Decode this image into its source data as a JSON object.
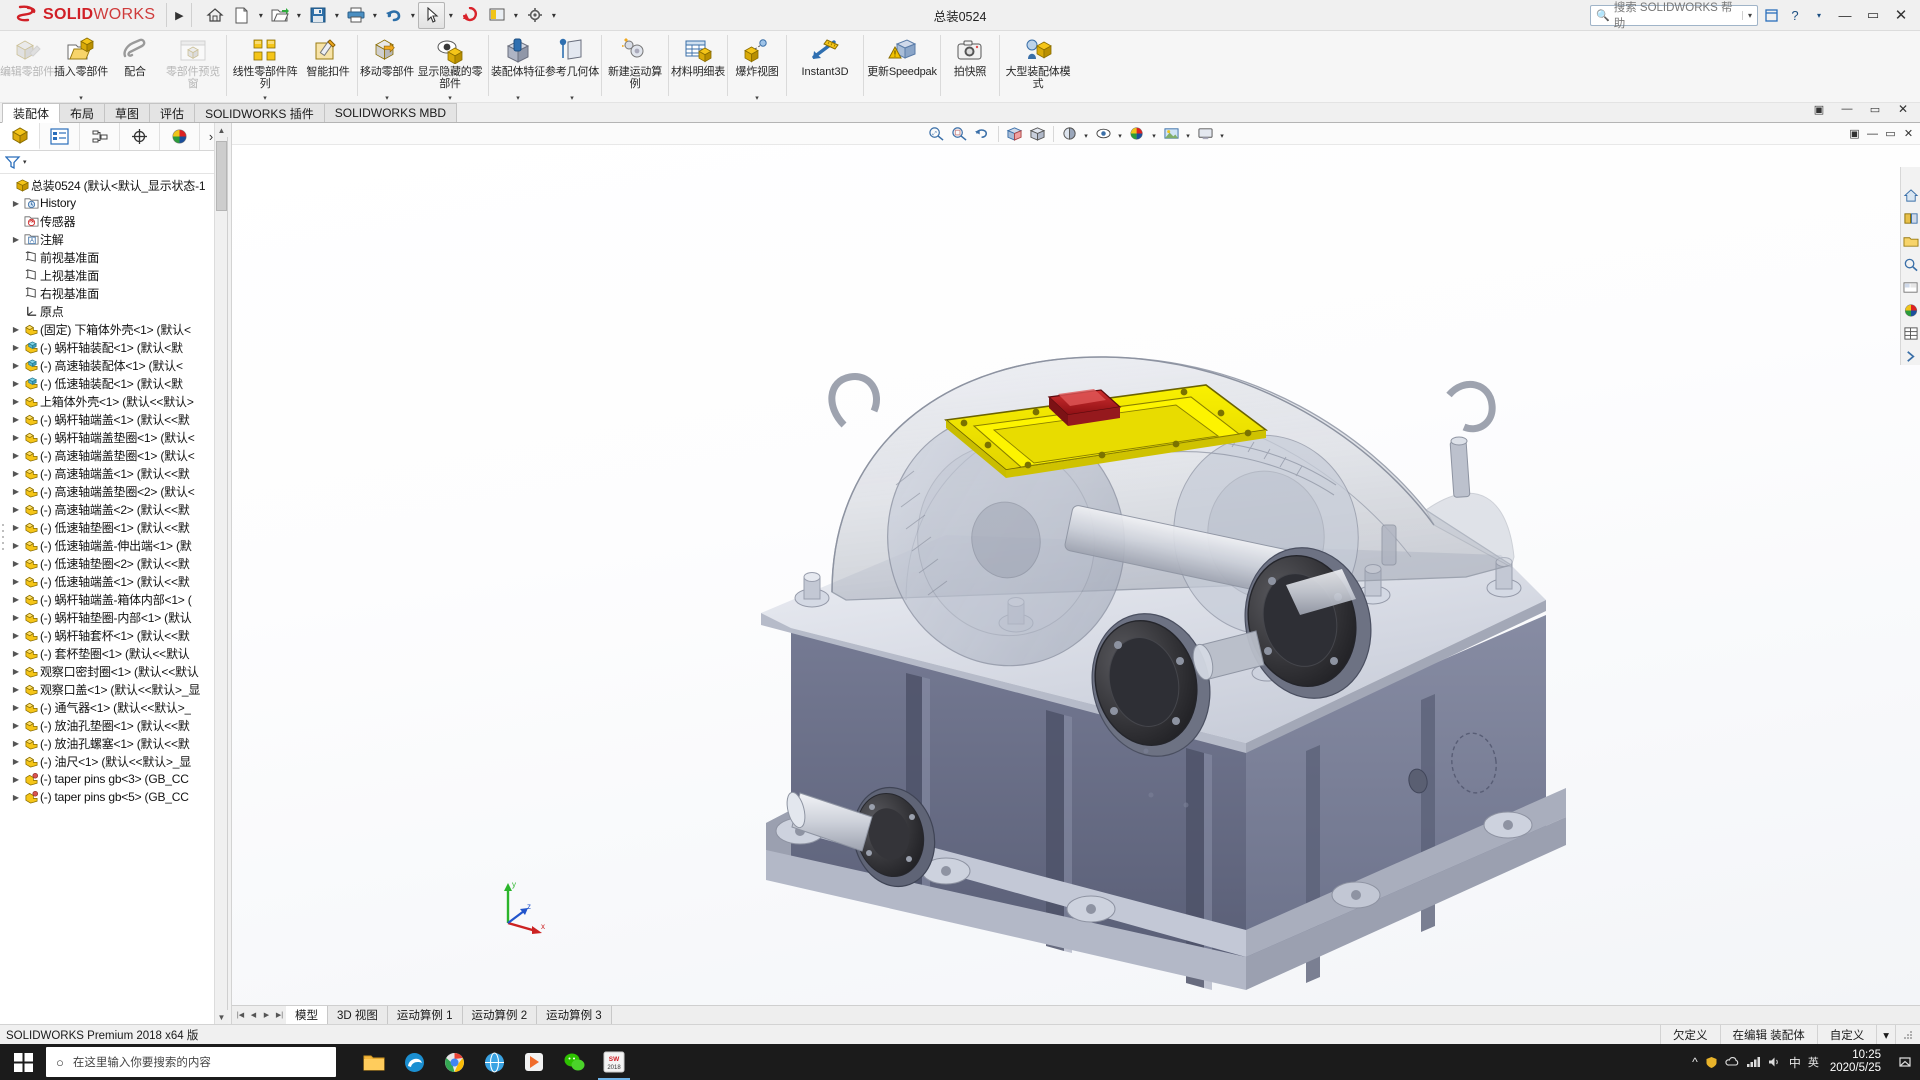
{
  "titlebar": {
    "logo_mark": "DS",
    "logo_bold": "SOLID",
    "logo_light": "WORKS",
    "document_title": "总装0524",
    "quick_access": [
      {
        "name": "home-icon",
        "label": "主页"
      },
      {
        "name": "new-document-icon",
        "label": "新建"
      },
      {
        "name": "open-folder-icon",
        "label": "打开"
      },
      {
        "name": "save-icon",
        "label": "保存"
      },
      {
        "name": "print-icon",
        "label": "打印"
      },
      {
        "name": "undo-icon",
        "label": "撤销"
      },
      {
        "name": "select-cursor-icon",
        "label": "选择"
      },
      {
        "name": "rebuild-icon",
        "label": "重建模型"
      },
      {
        "name": "display-icon",
        "label": "显示"
      },
      {
        "name": "options-gear-icon",
        "label": "选项"
      }
    ],
    "search_placeholder": "搜索 SOLIDWORKS 帮助",
    "help_label": "?",
    "minimize": "—",
    "maximize": "▭",
    "close": "✕"
  },
  "ribbon": {
    "items": [
      {
        "label": "编辑零部件",
        "icon": "edit-component-icon",
        "disabled": true,
        "caret": false
      },
      {
        "label": "插入零部件",
        "icon": "insert-component-icon",
        "disabled": false,
        "caret": true
      },
      {
        "label": "配合",
        "icon": "mate-icon",
        "disabled": false,
        "caret": false
      },
      {
        "label": "零部件预览窗",
        "icon": "component-preview-icon",
        "disabled": true,
        "caret": false
      },
      {
        "label": "线性零部件阵列",
        "icon": "linear-pattern-icon",
        "disabled": false,
        "caret": true
      },
      {
        "label": "智能扣件",
        "icon": "smart-fastener-icon",
        "disabled": false,
        "caret": false
      },
      {
        "label": "移动零部件",
        "icon": "move-component-icon",
        "disabled": false,
        "caret": true
      },
      {
        "label": "显示隐藏的零部件",
        "icon": "show-hidden-components-icon",
        "disabled": false,
        "caret": true
      },
      {
        "label": "装配体特征",
        "icon": "assembly-feature-icon",
        "disabled": false,
        "caret": true
      },
      {
        "label": "参考几何体",
        "icon": "reference-geometry-icon",
        "disabled": false,
        "caret": true
      },
      {
        "label": "新建运动算例",
        "icon": "new-motion-study-icon",
        "disabled": false,
        "caret": false
      },
      {
        "label": "材料明细表",
        "icon": "bill-of-materials-icon",
        "disabled": false,
        "caret": false
      },
      {
        "label": "爆炸视图",
        "icon": "exploded-view-icon",
        "disabled": false,
        "caret": true
      },
      {
        "label": "Instant3D",
        "icon": "instant3d-icon",
        "disabled": false,
        "caret": false,
        "en": true
      },
      {
        "label": "更新Speedpak",
        "icon": "update-speedpak-icon",
        "disabled": false,
        "caret": false
      },
      {
        "label": "拍快照",
        "icon": "take-snapshot-icon",
        "disabled": false,
        "caret": false
      },
      {
        "label": "大型装配体模式",
        "icon": "large-assembly-mode-icon",
        "disabled": false,
        "caret": false
      }
    ]
  },
  "command_tabs": {
    "items": [
      "装配体",
      "布局",
      "草图",
      "评估",
      "SOLIDWORKS 插件",
      "SOLIDWORKS MBD"
    ],
    "active_index": 0,
    "window_buttons": [
      "▣",
      "—",
      "▭",
      "✕"
    ]
  },
  "feature_manager": {
    "tabs": [
      {
        "name": "feature-tree-tab",
        "icon": "assembly-tree-icon",
        "active": true
      },
      {
        "name": "property-manager-tab",
        "icon": "property-manager-icon",
        "active": false
      },
      {
        "name": "configuration-manager-tab",
        "icon": "configuration-manager-icon",
        "active": false
      },
      {
        "name": "dimxpert-manager-tab",
        "icon": "dimxpert-icon",
        "active": false
      },
      {
        "name": "display-manager-tab",
        "icon": "display-manager-icon",
        "active": false
      }
    ],
    "more_tabs": "›",
    "filter_icon": "filter-funnel-icon",
    "tree": [
      {
        "label": "总装0524  (默认<默认_显示状态-1",
        "icon": "assembly-icon",
        "indent": 0,
        "expand": false,
        "root": true
      },
      {
        "label": "History",
        "icon": "history-icon",
        "indent": 1,
        "expand": true
      },
      {
        "label": "传感器",
        "icon": "sensors-icon",
        "indent": 1,
        "expand": false
      },
      {
        "label": "注解",
        "icon": "annotations-icon",
        "indent": 1,
        "expand": true
      },
      {
        "label": "前视基准面",
        "icon": "plane-icon",
        "indent": 1,
        "expand": false
      },
      {
        "label": "上视基准面",
        "icon": "plane-icon",
        "indent": 1,
        "expand": false
      },
      {
        "label": "右视基准面",
        "icon": "plane-icon",
        "indent": 1,
        "expand": false
      },
      {
        "label": "原点",
        "icon": "origin-icon",
        "indent": 1,
        "expand": false
      },
      {
        "label": "(固定) 下箱体外壳<1> (默认<",
        "icon": "part-icon",
        "indent": 1,
        "expand": true
      },
      {
        "label": "(-) 蜗杆轴装配<1> (默认<默",
        "icon": "subassembly-icon",
        "indent": 1,
        "expand": true
      },
      {
        "label": "(-) 高速轴装配体<1> (默认<",
        "icon": "subassembly-icon",
        "indent": 1,
        "expand": true
      },
      {
        "label": "(-) 低速轴装配<1> (默认<默",
        "icon": "subassembly-icon",
        "indent": 1,
        "expand": true
      },
      {
        "label": "上箱体外壳<1> (默认<<默认>",
        "icon": "part-icon",
        "indent": 1,
        "expand": true
      },
      {
        "label": "(-) 蜗杆轴端盖<1> (默认<<默",
        "icon": "part-icon",
        "indent": 1,
        "expand": true
      },
      {
        "label": "(-) 蜗杆轴端盖垫圈<1> (默认<",
        "icon": "part-icon",
        "indent": 1,
        "expand": true
      },
      {
        "label": "(-) 高速轴端盖垫圈<1> (默认<",
        "icon": "part-icon",
        "indent": 1,
        "expand": true
      },
      {
        "label": "(-) 高速轴端盖<1> (默认<<默",
        "icon": "part-icon",
        "indent": 1,
        "expand": true
      },
      {
        "label": "(-) 高速轴端盖垫圈<2> (默认<",
        "icon": "part-icon",
        "indent": 1,
        "expand": true
      },
      {
        "label": "(-) 高速轴端盖<2> (默认<<默",
        "icon": "part-icon",
        "indent": 1,
        "expand": true
      },
      {
        "label": "(-) 低速轴垫圈<1> (默认<<默",
        "icon": "part-icon",
        "indent": 1,
        "expand": true
      },
      {
        "label": "(-) 低速轴端盖-伸出端<1> (默",
        "icon": "part-icon",
        "indent": 1,
        "expand": true
      },
      {
        "label": "(-) 低速轴垫圈<2> (默认<<默",
        "icon": "part-icon",
        "indent": 1,
        "expand": true
      },
      {
        "label": "(-) 低速轴端盖<1> (默认<<默",
        "icon": "part-icon",
        "indent": 1,
        "expand": true
      },
      {
        "label": "(-) 蜗杆轴端盖-箱体内部<1> (",
        "icon": "part-icon",
        "indent": 1,
        "expand": true
      },
      {
        "label": "(-) 蜗杆轴垫圈-内部<1> (默认",
        "icon": "part-icon",
        "indent": 1,
        "expand": true
      },
      {
        "label": "(-) 蜗杆轴套杯<1> (默认<<默",
        "icon": "part-icon",
        "indent": 1,
        "expand": true
      },
      {
        "label": "(-) 套杯垫圈<1> (默认<<默认",
        "icon": "part-icon",
        "indent": 1,
        "expand": true
      },
      {
        "label": "观察口密封圈<1> (默认<<默认",
        "icon": "part-icon",
        "indent": 1,
        "expand": true
      },
      {
        "label": "观察口盖<1> (默认<<默认>_显",
        "icon": "part-icon",
        "indent": 1,
        "expand": true
      },
      {
        "label": "(-) 通气器<1> (默认<<默认>_",
        "icon": "part-icon",
        "indent": 1,
        "expand": true
      },
      {
        "label": "(-) 放油孔垫圈<1> (默认<<默",
        "icon": "part-icon",
        "indent": 1,
        "expand": true
      },
      {
        "label": "(-) 放油孔螺塞<1> (默认<<默",
        "icon": "part-icon",
        "indent": 1,
        "expand": true
      },
      {
        "label": "(-) 油尺<1> (默认<<默认>_显",
        "icon": "part-icon",
        "indent": 1,
        "expand": true
      },
      {
        "label": "(-) taper pins gb<3> (GB_CC",
        "icon": "toolbox-part-icon",
        "indent": 1,
        "expand": true
      },
      {
        "label": "(-) taper pins gb<5> (GB_CC",
        "icon": "toolbox-part-icon",
        "indent": 1,
        "expand": true
      }
    ]
  },
  "view_toolbar": {
    "buttons": [
      {
        "name": "zoom-to-fit-icon",
        "glyph": "zf"
      },
      {
        "name": "zoom-to-area-icon",
        "glyph": "za"
      },
      {
        "name": "previous-view-icon",
        "glyph": "pv"
      },
      {
        "name": "section-view-icon",
        "glyph": "sv"
      },
      {
        "name": "view-orientation-icon",
        "glyph": "vo"
      },
      {
        "name": "display-style-icon",
        "glyph": "ds",
        "caret": true
      },
      {
        "name": "hide-show-items-icon",
        "glyph": "hs",
        "caret": true
      },
      {
        "name": "edit-appearance-icon",
        "glyph": "ea",
        "caret": true
      },
      {
        "name": "apply-scene-icon",
        "glyph": "as",
        "caret": true
      },
      {
        "name": "view-settings-icon",
        "glyph": "vs",
        "caret": true
      }
    ],
    "window_buttons": [
      "▣",
      "—",
      "▭",
      "✕"
    ]
  },
  "right_dock": {
    "items": [
      {
        "name": "view-palette-icon",
        "glyph": "home"
      },
      {
        "name": "design-library-icon",
        "glyph": "lib"
      },
      {
        "name": "file-explorer-icon",
        "glyph": "fold"
      },
      {
        "name": "search-library-icon",
        "glyph": "srch"
      },
      {
        "name": "view-palette-panel-icon",
        "glyph": "pal"
      },
      {
        "name": "appearances-icon",
        "glyph": "appr"
      },
      {
        "name": "custom-properties-icon",
        "glyph": "prop"
      },
      {
        "name": "dock-expand-icon",
        "glyph": "exp"
      }
    ]
  },
  "model_tabs": {
    "nav": [
      "|◀",
      "◀",
      "▶",
      "▶|"
    ],
    "items": [
      "模型",
      "3D 视图",
      "运动算例 1",
      "运动算例 2",
      "运动算例 3"
    ],
    "active_index": 0
  },
  "statusbar": {
    "left": "SOLIDWORKS Premium 2018 x64 版",
    "cells": [
      "欠定义",
      "在编辑 装配体",
      "自定义",
      "▾"
    ]
  },
  "taskbar": {
    "search_placeholder": "在这里输入你要搜索的内容",
    "start_icon": "windows-start-icon",
    "apps": [
      {
        "name": "file-explorer-taskbar-icon",
        "glyph": "folder"
      },
      {
        "name": "edge-browser-icon",
        "glyph": "edge"
      },
      {
        "name": "chrome-browser-icon",
        "glyph": "chrome"
      },
      {
        "name": "browser-blue-icon",
        "glyph": "blue"
      },
      {
        "name": "media-app-icon",
        "glyph": "media"
      },
      {
        "name": "wechat-icon",
        "glyph": "wechat"
      },
      {
        "name": "solidworks-taskbar-icon",
        "glyph": "sw",
        "active": true
      }
    ],
    "tray": [
      {
        "name": "tray-expand-icon",
        "glyph": "^"
      },
      {
        "name": "tray-shield-icon",
        "glyph": "shield"
      },
      {
        "name": "tray-cloud-icon",
        "glyph": "cloud"
      },
      {
        "name": "tray-network-icon",
        "glyph": "net"
      },
      {
        "name": "tray-volume-icon",
        "glyph": "vol"
      },
      {
        "name": "tray-ime-icon",
        "glyph": "中"
      },
      {
        "name": "tray-lang-icon",
        "glyph": "英"
      }
    ],
    "clock_time": "10:25",
    "clock_date": "2020/5/25",
    "notification_icon": "notification-bell-icon"
  },
  "colors": {
    "brand_red": "#d12027",
    "accent_yellow": "#f2e200",
    "highlight_red": "#b01515",
    "housing_gray": "#6a6a7e",
    "titlebar_bg": "#f0f0f0",
    "ribbon_bg": "#f6f6f6",
    "taskbar_bg": "#1b1b1b"
  },
  "model": {
    "description": "减速器总装配体 3D 模型",
    "parts_visible": [
      "上箱体透明外壳",
      "观察口盖(黄色)",
      "通气器(红色)",
      "下箱体",
      "高速轴",
      "低速轴",
      "蜗杆轴",
      "端盖",
      "螺栓"
    ]
  }
}
